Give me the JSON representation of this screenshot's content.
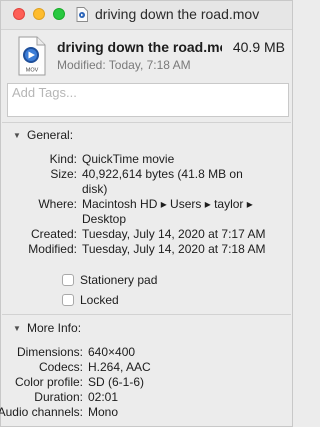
{
  "window": {
    "title": "driving down the road.mov"
  },
  "header": {
    "name": "driving down the road.mov",
    "size": "40.9 MB",
    "modified": "Modified: Today, 7:18 AM",
    "icon_label": "MOV"
  },
  "tags": {
    "placeholder": "Add Tags..."
  },
  "general": {
    "header": "General:",
    "rows": [
      {
        "key": "Kind:",
        "value": "QuickTime movie"
      },
      {
        "key": "Size:",
        "value": "40,922,614 bytes (41.8 MB on disk)"
      },
      {
        "key": "Where:",
        "value": "Macintosh HD ▸ Users ▸ taylor ▸ Desktop"
      },
      {
        "key": "Created:",
        "value": "Tuesday, July 14, 2020 at 7:17 AM"
      },
      {
        "key": "Modified:",
        "value": "Tuesday, July 14, 2020 at 7:18 AM"
      }
    ],
    "stationery_label": "Stationery pad",
    "stationery_checked": false,
    "locked_label": "Locked",
    "locked_checked": false
  },
  "more_info": {
    "header": "More Info:",
    "rows": [
      {
        "key": "Dimensions:",
        "value": "640×400"
      },
      {
        "key": "Codecs:",
        "value": "H.264, AAC"
      },
      {
        "key": "Color profile:",
        "value": "SD (6-1-6)"
      },
      {
        "key": "Duration:",
        "value": "02:01"
      },
      {
        "key": "Audio channels:",
        "value": "Mono"
      }
    ]
  },
  "colors": {
    "close": "#fe5f57",
    "minimize": "#febc2e",
    "maximize": "#28c840",
    "icon_badge": "#2a63b8"
  },
  "icons": [
    "movie-file-icon",
    "disclosure-triangle-icon"
  ]
}
